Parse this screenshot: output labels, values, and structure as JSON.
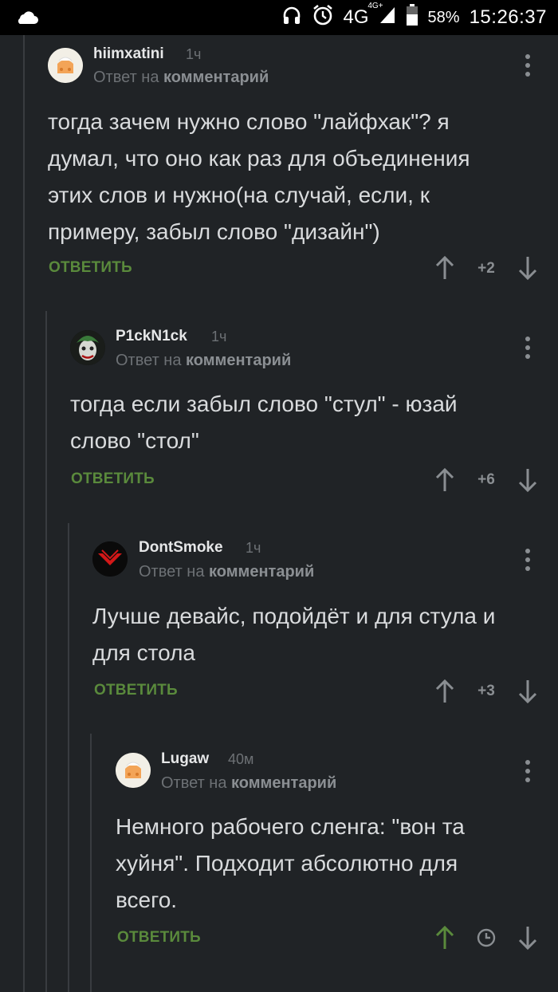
{
  "status_bar": {
    "network": "4G",
    "network_sup": "4G+",
    "battery": "58%",
    "time": "15:26:37"
  },
  "reply_prefix": "Ответ на",
  "reply_target": "комментарий",
  "reply_button": "ОТВЕТИТЬ",
  "comments": [
    {
      "username": "hiimxatini",
      "time": "1ч",
      "text": "тогда зачем нужно слово \"лайфхак\"? я\nдумал, что оно как раз для объединения\nэтих слов и нужно(на случай, если, к\nпримеру, забыл слово \"дизайн\")",
      "score": "+2"
    },
    {
      "username": "P1ckN1ck",
      "time": "1ч",
      "text": "тогда если забыл слово \"стул\" - юзай\nслово \"стол\"",
      "score": "+6"
    },
    {
      "username": "DontSmoke",
      "time": "1ч",
      "text": "Лучше девайс, подойдёт и для стула и\nдля стола",
      "score": "+3"
    },
    {
      "username": "Lugaw",
      "time": "40м",
      "text": "Немного рабочего сленга: \"вон та\nхуйня\". Подходит абсолютно для\nвсего.",
      "score": ""
    }
  ],
  "colors": {
    "background": "#202326",
    "accent_green": "#5a8a3c",
    "upvote_active": "#5a8a3c",
    "muted": "#6d7175"
  }
}
